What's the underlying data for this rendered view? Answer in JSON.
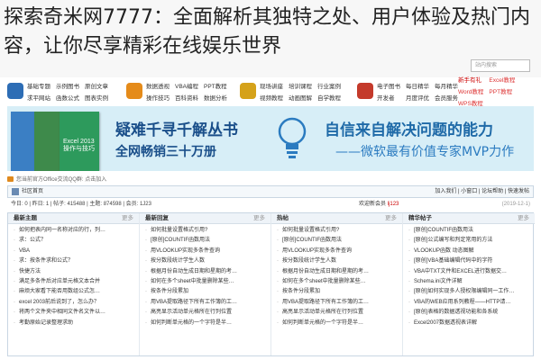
{
  "headline": "探索奇米网7777：全面解析其独特之处、用户体验及热门内容，让你尽享精彩在线娱乐世界",
  "search": {
    "placeholder": "站内搜索"
  },
  "nav": {
    "groups": [
      {
        "icon": "home-icon",
        "color": "#2d6db5",
        "links": [
          "基础专题",
          "示例图书",
          "原创文章",
          "求平网站",
          "函数公式",
          "图表实例"
        ]
      },
      {
        "icon": "chart-icon",
        "color": "#e58b1a",
        "links": [
          "数据透视",
          "VBA编程",
          "PPT教程",
          "操作技巧",
          "百科资料",
          "数据分析"
        ]
      },
      {
        "icon": "folder-icon",
        "color": "#d5a21a",
        "links": [
          "现场讲座",
          "培训课程",
          "行业案例",
          "视频教程",
          "动画图解",
          "自学教程"
        ]
      },
      {
        "icon": "book-icon",
        "color": "#c43a2b",
        "links": [
          "电子图书",
          "每日精华",
          "每月精华",
          "开发者",
          "月度评优",
          "会员服务"
        ]
      }
    ],
    "extra_links": [
      "新手有礼",
      "Excel教程",
      "Word教程",
      "PPT教程",
      "WPS教程"
    ]
  },
  "banner": {
    "left_line1": "疑难千寻千解丛书",
    "left_line2": "全网畅销三十万册",
    "right_line1": "自信来自解决问题的能力",
    "right_line2": "——微软最有价值专家MVP力作",
    "book_title": "Excel 2013操作与技巧"
  },
  "notice": {
    "text": "您当前官方Office交流QQ群: 点击加入"
  },
  "crumb": {
    "home": "社区首页",
    "right": "加入我们 | 小窗口 | 论坛帮助 | 快速发帖"
  },
  "stats": {
    "left": "今日: 0 | 昨日: 1 | 帖子: 415488 | 主题: 874598 | 会员: 1J23",
    "mid_prefix": "欢迎新会员",
    "mid_user": "lj123",
    "right": "(2019-12-1)"
  },
  "columns": [
    {
      "title": "最新主题",
      "items": [
        "如何把表内同一名称对应的行，列…",
        "求：公式？",
        "VBA",
        "求：按条件求和公式？",
        "快捷方法",
        "满足多条件后对应单元格文本合并",
        "麻烦大家看下能否用数组公式怎…",
        "excel 2003前后说到了，怎么办？",
        "将两个文件夹中相同文件名文件以…",
        "考勤原始记录整理求助"
      ]
    },
    {
      "title": "最新回复",
      "items": [
        "如何批量设置格式引用?",
        "[原创]COUNTIF函数用法",
        "用VLOOKUP实现多条件查询",
        "按分数段统计学生人数",
        "根据月份自动生成日期和星期的考…",
        "如何在多个sheet中批量删除某些…",
        "按条件分段累加",
        "用VBA提取路径下所有工作簿的工…",
        "高亮显示活动单元格所在行列位置",
        "如何判断单元格的一个字符是半…"
      ]
    },
    {
      "title": "热帖",
      "items": [
        "如何批量设置格式引用?",
        "[原创]COUNTIF函数用法",
        "用VLOOKUP实现多条件查询",
        "按分数段统计学生人数",
        "根据月份自动生成日期和星期的考…",
        "如何在多个sheet中批量删除某些…",
        "按条件分段累加",
        "用VBA提取路径下所有工作簿的工…",
        "高亮显示活动单元格所在行列位置",
        "如何判断单元格的一个字符是半…"
      ]
    },
    {
      "title": "精华帖子",
      "items": [
        "[原创]COUNTIF函数用法",
        "[原创]公式编写和判定常用的方法",
        "VLOOKUP函数 动态图解",
        "[原创]VBA基础编辑代码中的字符",
        "VBA中TXT文件和EXCEL进行数据交…",
        "Schema.ini文件详解",
        "[原创]如何实现多人授权限编辑同一工作…",
        "VBA的WEB应用系列教程——HTTP请…",
        "[原创]表格的数据透视功能和各系统",
        "Excel2007数据透视表详解"
      ]
    }
  ],
  "more_label": "更多"
}
